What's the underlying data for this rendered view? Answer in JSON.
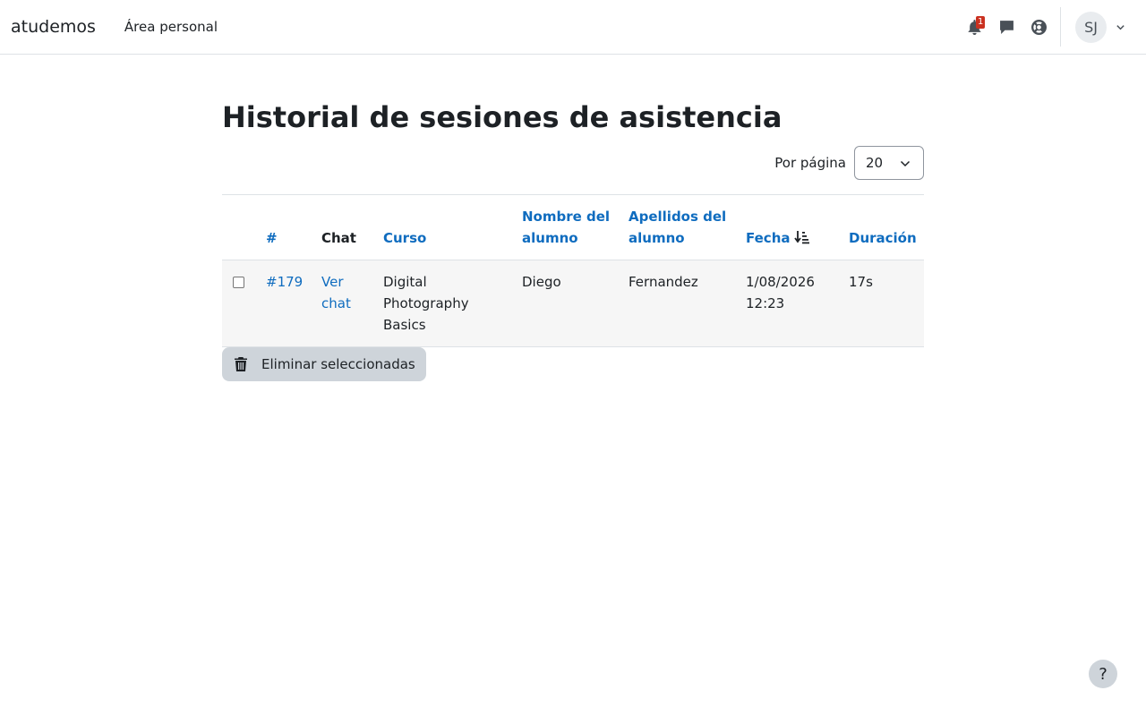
{
  "navbar": {
    "brand": "atudemos",
    "link": "Área personal",
    "notifications_count": "1",
    "user_initials": "SJ"
  },
  "page": {
    "title": "Historial de sesiones de asistencia",
    "per_page_label": "Por página",
    "per_page_value": "20"
  },
  "table": {
    "headers": {
      "number": "#",
      "chat": "Chat",
      "course": "Curso",
      "student_name": "Nombre del alumno",
      "student_surname": "Apellidos del alumno",
      "date": "Fecha",
      "duration": "Duración"
    },
    "rows": [
      {
        "number": "#179",
        "chat": "Ver chat",
        "course": "Digital Photography Basics",
        "name": "Diego",
        "surname": "Fernandez",
        "date": "1/08/2026 12:23",
        "duration": "17s"
      }
    ]
  },
  "actions": {
    "delete_selected": "Eliminar seleccionadas"
  },
  "help": "?",
  "colors": {
    "link": "#0f6cbf",
    "badge": "#ca3120",
    "button_bg": "#ced4da"
  }
}
